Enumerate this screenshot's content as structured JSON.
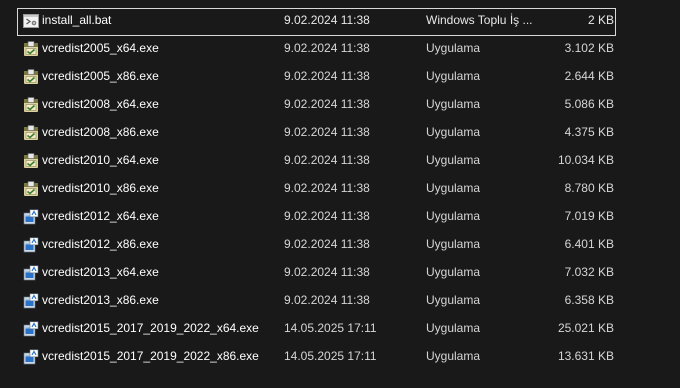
{
  "files": [
    {
      "name": "install_all.bat",
      "date": "9.02.2024 11:38",
      "type": "Windows Toplu İş ...",
      "size": "2 KB",
      "icon": "batch-file-icon",
      "focused": true
    },
    {
      "name": "vcredist2005_x64.exe",
      "date": "9.02.2024 11:38",
      "type": "Uygulama",
      "size": "3.102 KB",
      "icon": "installer-icon"
    },
    {
      "name": "vcredist2005_x86.exe",
      "date": "9.02.2024 11:38",
      "type": "Uygulama",
      "size": "2.644 KB",
      "icon": "installer-icon"
    },
    {
      "name": "vcredist2008_x64.exe",
      "date": "9.02.2024 11:38",
      "type": "Uygulama",
      "size": "5.086 KB",
      "icon": "installer-icon"
    },
    {
      "name": "vcredist2008_x86.exe",
      "date": "9.02.2024 11:38",
      "type": "Uygulama",
      "size": "4.375 KB",
      "icon": "installer-icon"
    },
    {
      "name": "vcredist2010_x64.exe",
      "date": "9.02.2024 11:38",
      "type": "Uygulama",
      "size": "10.034 KB",
      "icon": "installer-icon"
    },
    {
      "name": "vcredist2010_x86.exe",
      "date": "9.02.2024 11:38",
      "type": "Uygulama",
      "size": "8.780 KB",
      "icon": "installer-icon"
    },
    {
      "name": "vcredist2012_x64.exe",
      "date": "9.02.2024 11:38",
      "type": "Uygulama",
      "size": "7.019 KB",
      "icon": "setup-icon"
    },
    {
      "name": "vcredist2012_x86.exe",
      "date": "9.02.2024 11:38",
      "type": "Uygulama",
      "size": "6.401 KB",
      "icon": "setup-icon"
    },
    {
      "name": "vcredist2013_x64.exe",
      "date": "9.02.2024 11:38",
      "type": "Uygulama",
      "size": "7.032 KB",
      "icon": "setup-icon"
    },
    {
      "name": "vcredist2013_x86.exe",
      "date": "9.02.2024 11:38",
      "type": "Uygulama",
      "size": "6.358 KB",
      "icon": "setup-icon"
    },
    {
      "name": "vcredist2015_2017_2019_2022_x64.exe",
      "date": "14.05.2025 17:11",
      "type": "Uygulama",
      "size": "25.021 KB",
      "icon": "setup-icon"
    },
    {
      "name": "vcredist2015_2017_2019_2022_x86.exe",
      "date": "14.05.2025 17:11",
      "type": "Uygulama",
      "size": "13.631 KB",
      "icon": "setup-icon"
    }
  ],
  "colors": {
    "background": "#191919",
    "text": "#ffffff",
    "focus_outline": "#d8d8d8"
  }
}
